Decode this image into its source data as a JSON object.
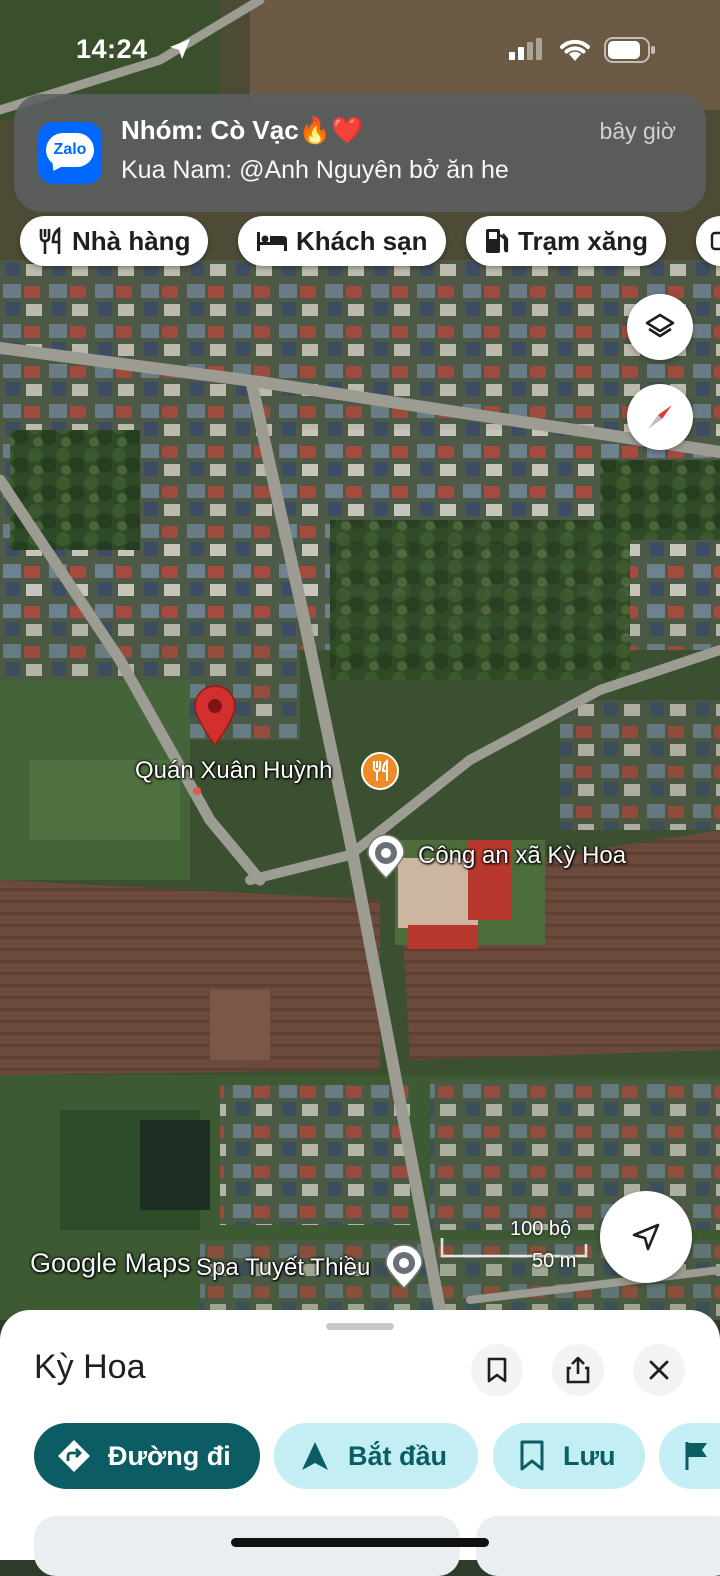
{
  "status_bar": {
    "time": "14:24"
  },
  "notification": {
    "app_name": "Zalo",
    "title": "Nhóm: Cò Vạc🔥❤️",
    "time": "bây giờ",
    "body": "Kua Nam: @Anh Nguyên bở ăn he"
  },
  "chips": [
    {
      "label": "Nhà hàng",
      "icon": "fork-knife-icon"
    },
    {
      "label": "Khách sạn",
      "icon": "bed-icon"
    },
    {
      "label": "Trạm xăng",
      "icon": "gas-station-icon"
    }
  ],
  "map": {
    "labels": {
      "restaurant": "Quán Xuân Huỳnh",
      "police": "Công an xã Kỳ Hoa",
      "spa": "Spa Tuyết Thiều"
    },
    "watermark": "Google Maps",
    "scale": {
      "imperial": "100 bộ",
      "metric": "50 m"
    }
  },
  "sheet": {
    "title": "Kỳ Hoa",
    "actions": [
      {
        "label": "Đường đi",
        "icon": "directions-icon"
      },
      {
        "label": "Bắt đầu",
        "icon": "navigation-arrow-icon"
      },
      {
        "label": "Lưu",
        "icon": "bookmark-icon"
      }
    ]
  }
}
